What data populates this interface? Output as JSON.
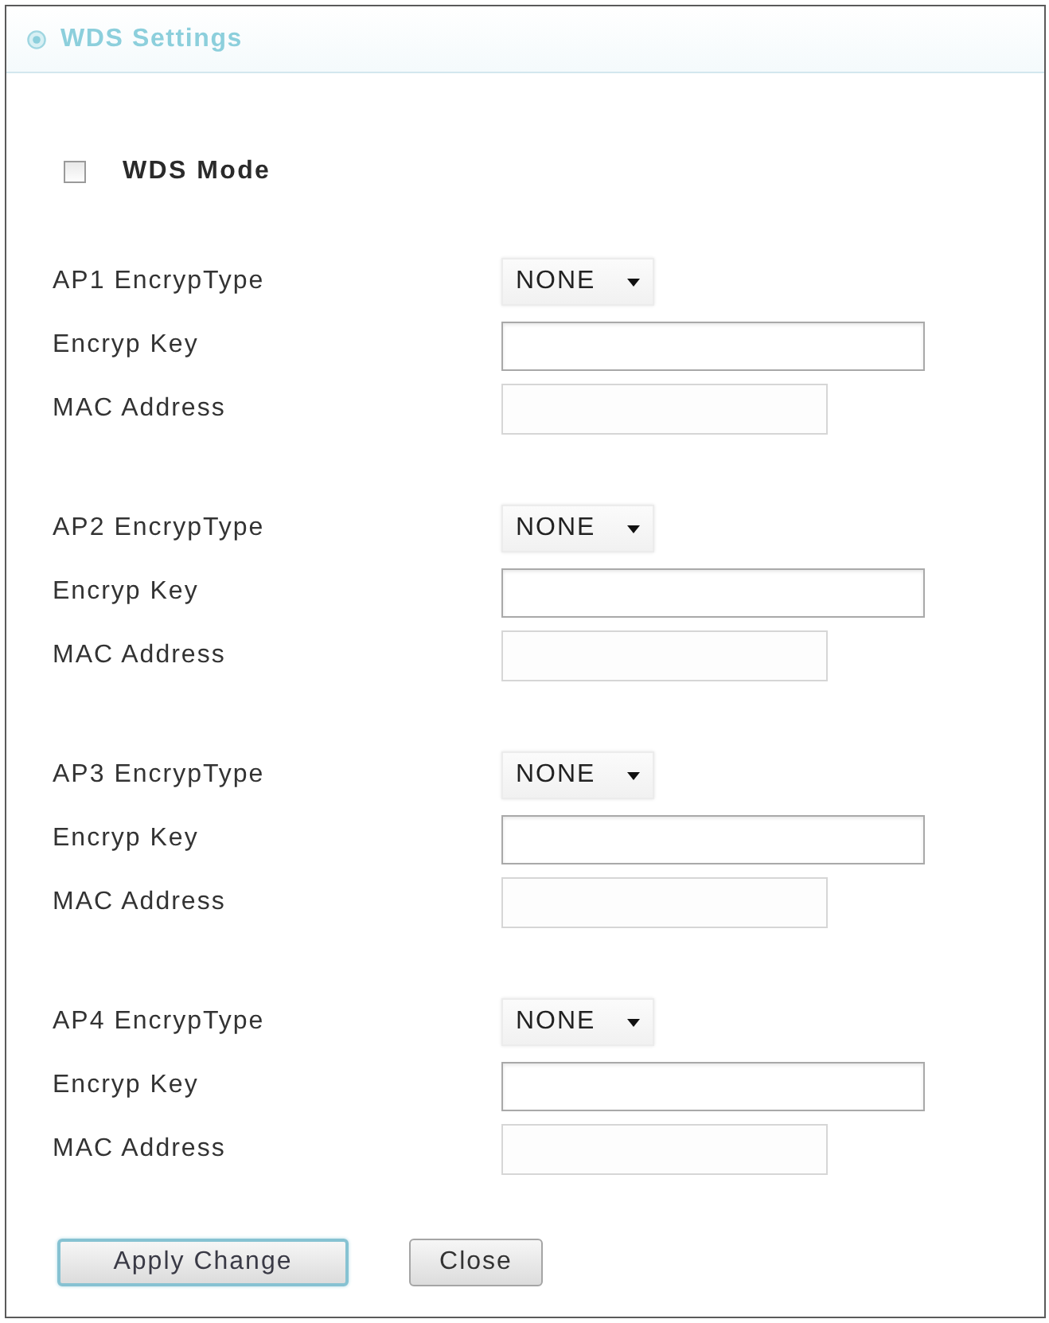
{
  "panel": {
    "title": "WDS Settings"
  },
  "wds_mode": {
    "label": "WDS Mode",
    "checked": false
  },
  "access_points": [
    {
      "fields": [
        {
          "kind": "select",
          "label": "AP1 EncrypType",
          "value": "NONE"
        },
        {
          "kind": "text",
          "label": "Encryp Key",
          "disabled": false
        },
        {
          "kind": "text",
          "label": "MAC Address",
          "disabled": true
        }
      ]
    },
    {
      "fields": [
        {
          "kind": "select",
          "label": "AP2 EncrypType",
          "value": "NONE"
        },
        {
          "kind": "text",
          "label": "Encryp Key",
          "disabled": false
        },
        {
          "kind": "text",
          "label": "MAC Address",
          "disabled": true
        }
      ]
    },
    {
      "fields": [
        {
          "kind": "select",
          "label": "AP3 EncrypType",
          "value": "NONE"
        },
        {
          "kind": "text",
          "label": "Encryp Key",
          "disabled": false
        },
        {
          "kind": "text",
          "label": "MAC Address",
          "disabled": true
        }
      ]
    },
    {
      "fields": [
        {
          "kind": "select",
          "label": "AP4 EncrypType",
          "value": "NONE"
        },
        {
          "kind": "text",
          "label": "Encryp Key",
          "disabled": false
        },
        {
          "kind": "text",
          "label": "MAC Address",
          "disabled": true
        }
      ]
    }
  ],
  "buttons": [
    {
      "label": "Apply Change",
      "kind": "primary"
    },
    {
      "label": "Close",
      "kind": "secondary"
    }
  ]
}
